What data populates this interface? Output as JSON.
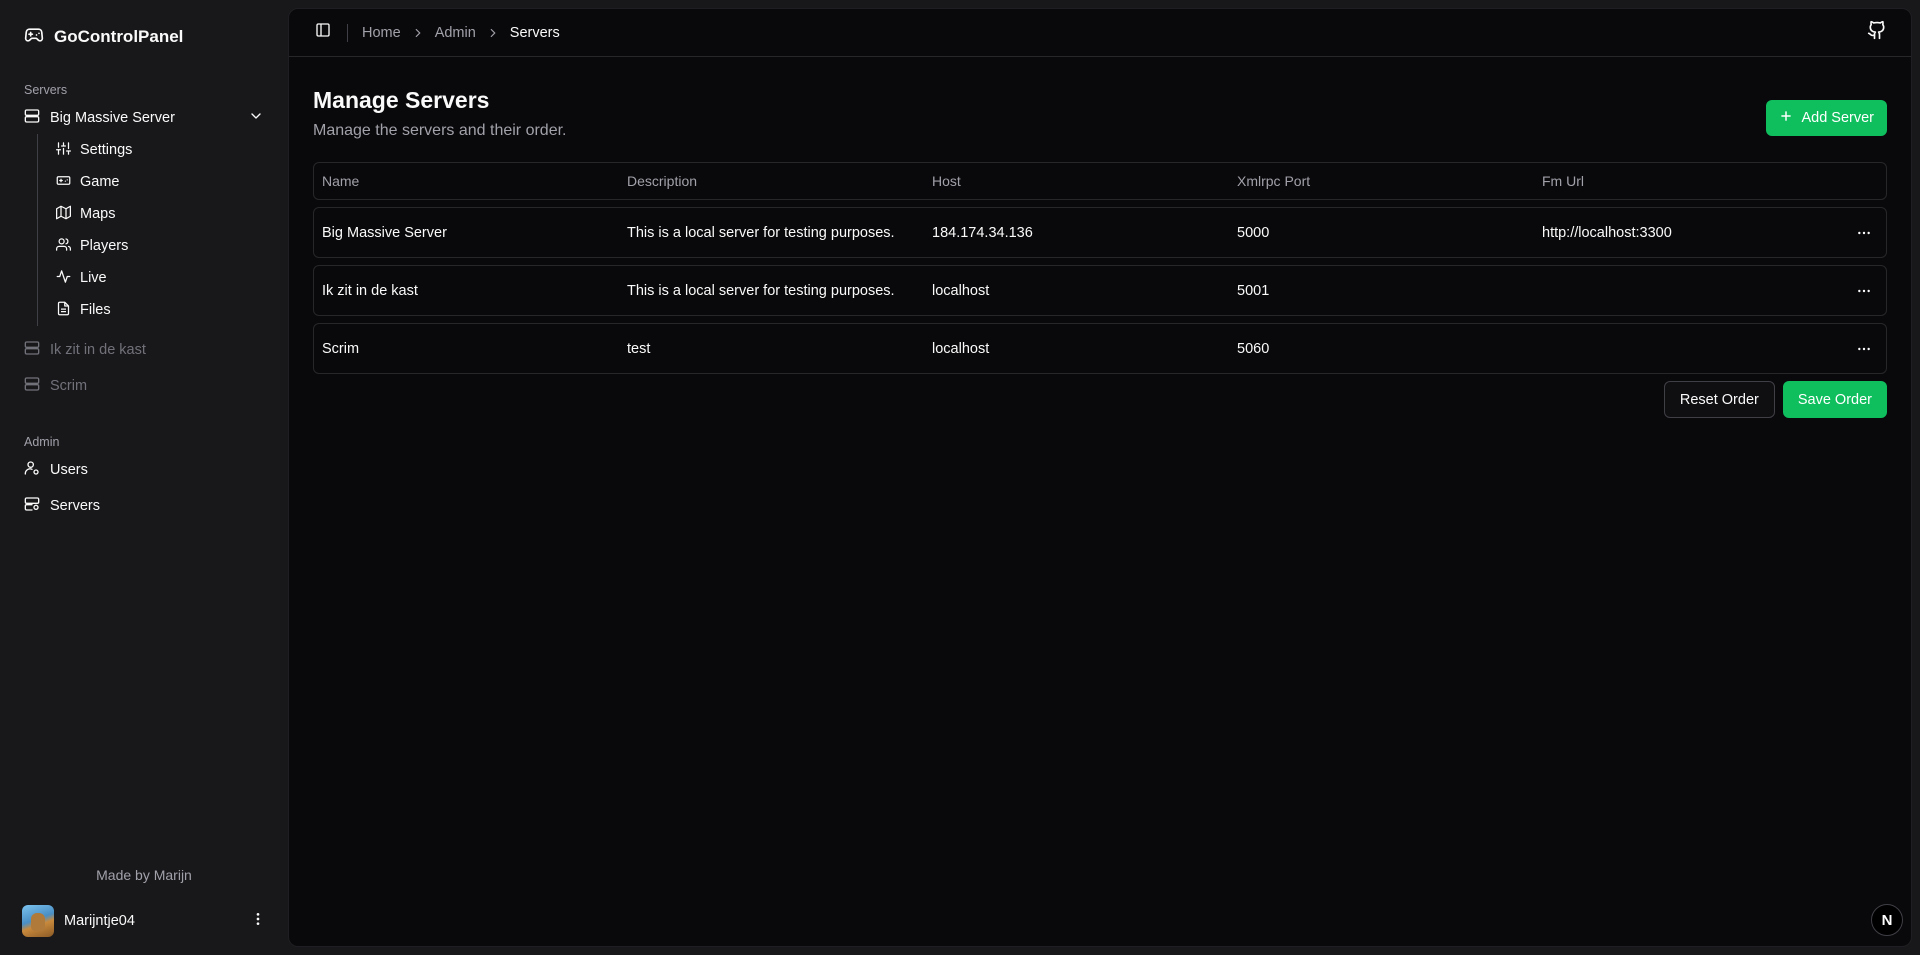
{
  "app": {
    "name": "GoControlPanel"
  },
  "sidebar": {
    "servers_label": "Servers",
    "active_server": {
      "label": "Big Massive Server",
      "items": [
        {
          "label": "Settings",
          "icon": "sliders-icon"
        },
        {
          "label": "Game",
          "icon": "gamepad-icon"
        },
        {
          "label": "Maps",
          "icon": "map-icon"
        },
        {
          "label": "Players",
          "icon": "users-icon"
        },
        {
          "label": "Live",
          "icon": "activity-icon"
        },
        {
          "label": "Files",
          "icon": "file-icon"
        }
      ]
    },
    "other_servers": [
      {
        "label": "Ik zit in de kast"
      },
      {
        "label": "Scrim"
      }
    ],
    "admin_label": "Admin",
    "admin_items": [
      {
        "label": "Users",
        "icon": "user-cog-icon"
      },
      {
        "label": "Servers",
        "icon": "server-cog-icon"
      }
    ],
    "footer": "Made by Marijn",
    "user": {
      "name": "Marijntje04"
    }
  },
  "topbar": {
    "breadcrumbs": [
      "Home",
      "Admin",
      "Servers"
    ]
  },
  "page": {
    "title": "Manage Servers",
    "subtitle": "Manage the servers and their order.",
    "add_button": "Add Server",
    "reset_button": "Reset Order",
    "save_button": "Save Order"
  },
  "table": {
    "headers": [
      "Name",
      "Description",
      "Host",
      "Xmlrpc Port",
      "Fm Url"
    ],
    "rows": [
      [
        "Big Massive Server",
        "This is a local server for testing purposes.",
        "184.174.34.136",
        "5000",
        "http://localhost:3300"
      ],
      [
        "Ik zit in de kast",
        "This is a local server for testing purposes.",
        "localhost",
        "5001",
        ""
      ],
      [
        "Scrim",
        "test",
        "localhost",
        "5060",
        ""
      ]
    ]
  },
  "nextjs_badge": "N",
  "colors": {
    "accent": "#0fbf5e",
    "background": "#09090b",
    "sidebar": "#18181b"
  }
}
